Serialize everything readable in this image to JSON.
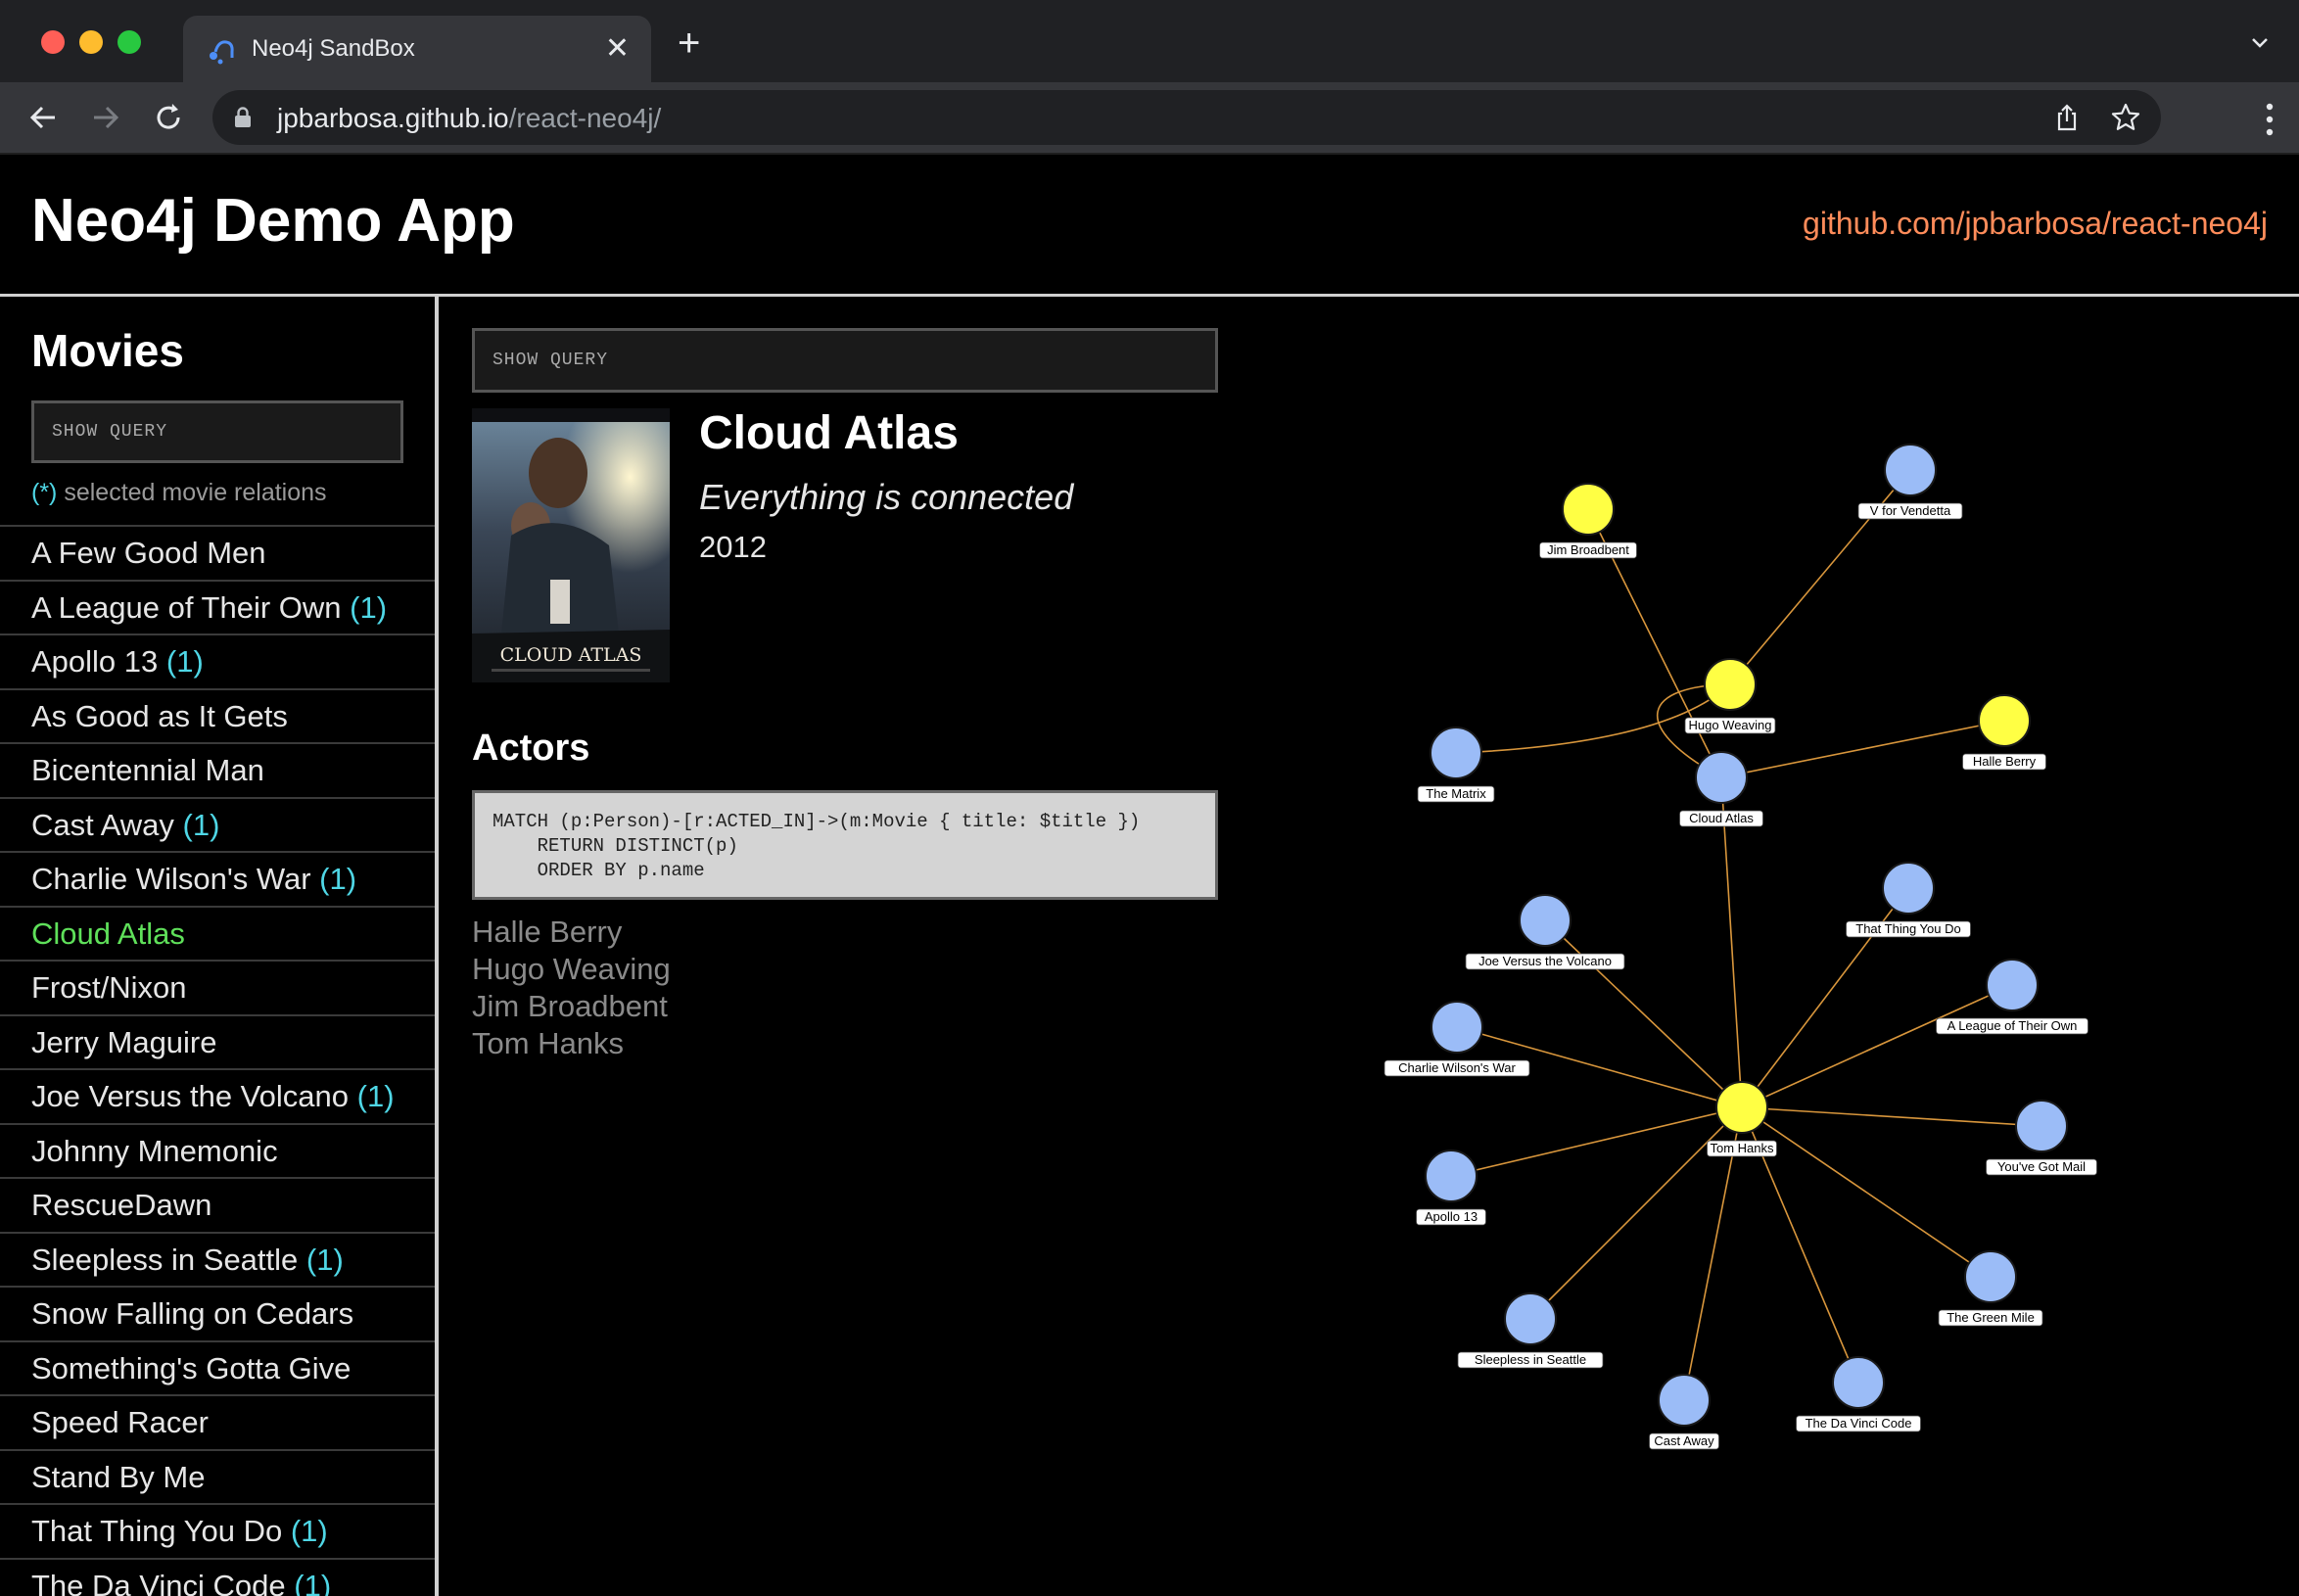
{
  "browser": {
    "tab_title": "Neo4j SandBox",
    "close_glyph": "✕",
    "new_tab_glyph": "+",
    "url_host": "jpbarbosa.github.io",
    "url_path": "/react-neo4j/"
  },
  "header": {
    "title": "Neo4j Demo App",
    "repo_link": "github.com/jpbarbosa/react-neo4j"
  },
  "sidebar": {
    "heading": "Movies",
    "query_button": "SHOW QUERY",
    "legend_mark": "(*)",
    "legend_text": "selected movie relations",
    "movies": [
      {
        "title": "A Few Good Men",
        "count": ""
      },
      {
        "title": "A League of Their Own",
        "count": "(1)"
      },
      {
        "title": "Apollo 13",
        "count": "(1)"
      },
      {
        "title": "As Good as It Gets",
        "count": ""
      },
      {
        "title": "Bicentennial Man",
        "count": ""
      },
      {
        "title": "Cast Away",
        "count": "(1)"
      },
      {
        "title": "Charlie Wilson's War",
        "count": "(1)"
      },
      {
        "title": "Cloud Atlas",
        "count": "",
        "selected": true
      },
      {
        "title": "Frost/Nixon",
        "count": ""
      },
      {
        "title": "Jerry Maguire",
        "count": ""
      },
      {
        "title": "Joe Versus the Volcano",
        "count": "(1)"
      },
      {
        "title": "Johnny Mnemonic",
        "count": ""
      },
      {
        "title": "RescueDawn",
        "count": ""
      },
      {
        "title": "Sleepless in Seattle",
        "count": "(1)"
      },
      {
        "title": "Snow Falling on Cedars",
        "count": ""
      },
      {
        "title": "Something's Gotta Give",
        "count": ""
      },
      {
        "title": "Speed Racer",
        "count": ""
      },
      {
        "title": "Stand By Me",
        "count": ""
      },
      {
        "title": "That Thing You Do",
        "count": "(1)"
      },
      {
        "title": "The Da Vinci Code",
        "count": "(1)"
      }
    ]
  },
  "movie": {
    "query_button": "SHOW QUERY",
    "poster_text": "CLOUD ATLAS",
    "title": "Cloud Atlas",
    "tagline": "Everything is connected",
    "released": "2012",
    "actors_heading": "Actors",
    "query": "MATCH (p:Person)-[r:ACTED_IN]->(m:Movie { title: $title })\n    RETURN DISTINCT(p)\n    ORDER BY p.name",
    "actors": [
      "Halle Berry",
      "Hugo Weaving",
      "Jim Broadbent",
      "Tom Hanks"
    ]
  },
  "graph": {
    "colors": {
      "person": "#ffff44",
      "movie": "#9bbcf7",
      "edge": "#d8963c",
      "stroke": "#1a1a1a"
    },
    "nodes": [
      {
        "id": "jim",
        "label": "Jim Broadbent",
        "kind": "person"
      },
      {
        "id": "vfv",
        "label": "V for Vendetta",
        "kind": "movie"
      },
      {
        "id": "hugo",
        "label": "Hugo Weaving",
        "kind": "person"
      },
      {
        "id": "halle",
        "label": "Halle Berry",
        "kind": "person"
      },
      {
        "id": "matrix",
        "label": "The Matrix",
        "kind": "movie"
      },
      {
        "id": "cloud",
        "label": "Cloud Atlas",
        "kind": "movie"
      },
      {
        "id": "joe",
        "label": "Joe Versus the Volcano",
        "kind": "movie"
      },
      {
        "id": "thing",
        "label": "That Thing You Do",
        "kind": "movie"
      },
      {
        "id": "league",
        "label": "A League of Their Own",
        "kind": "movie"
      },
      {
        "id": "charlie",
        "label": "Charlie Wilson's War",
        "kind": "movie"
      },
      {
        "id": "tom",
        "label": "Tom Hanks",
        "kind": "person"
      },
      {
        "id": "mail",
        "label": "You've Got Mail",
        "kind": "movie"
      },
      {
        "id": "apollo",
        "label": "Apollo 13",
        "kind": "movie"
      },
      {
        "id": "green",
        "label": "The Green Mile",
        "kind": "movie"
      },
      {
        "id": "sleepless",
        "label": "Sleepless in Seattle",
        "kind": "movie"
      },
      {
        "id": "davinci",
        "label": "The Da Vinci Code",
        "kind": "movie"
      },
      {
        "id": "castaway",
        "label": "Cast Away",
        "kind": "movie"
      }
    ],
    "edges": [
      [
        "jim",
        "cloud"
      ],
      [
        "hugo",
        "vfv"
      ],
      [
        "hugo",
        "matrix"
      ],
      [
        "hugo",
        "cloud"
      ],
      [
        "halle",
        "cloud"
      ],
      [
        "tom",
        "cloud"
      ],
      [
        "tom",
        "joe"
      ],
      [
        "tom",
        "thing"
      ],
      [
        "tom",
        "league"
      ],
      [
        "tom",
        "charlie"
      ],
      [
        "tom",
        "mail"
      ],
      [
        "tom",
        "apollo"
      ],
      [
        "tom",
        "green"
      ],
      [
        "tom",
        "sleepless"
      ],
      [
        "tom",
        "davinci"
      ],
      [
        "tom",
        "castaway"
      ]
    ]
  }
}
